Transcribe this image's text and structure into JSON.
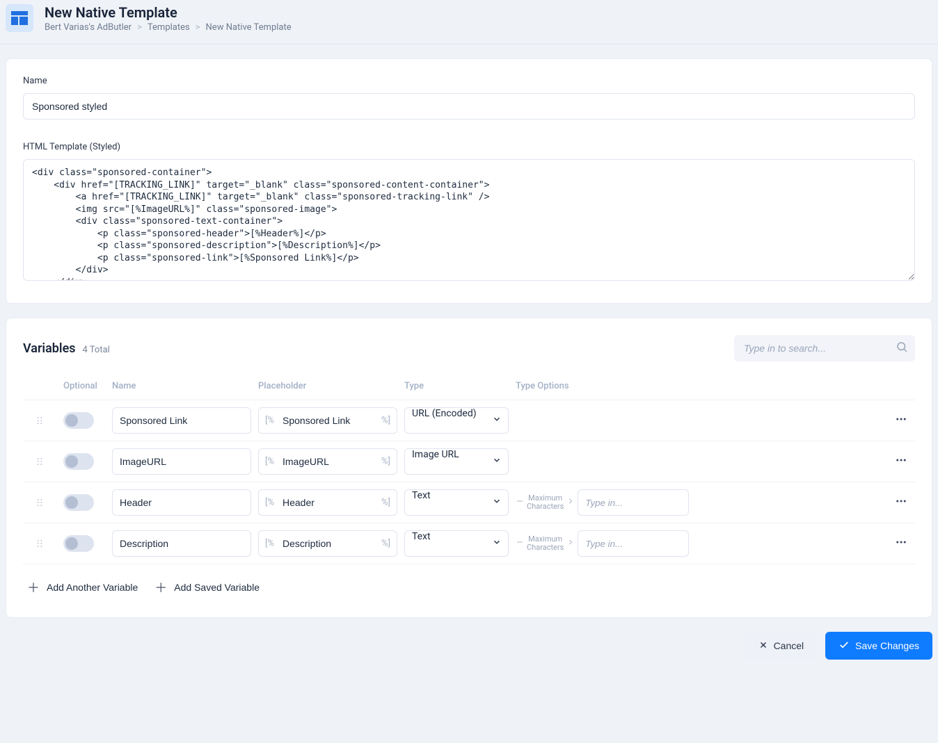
{
  "header": {
    "title": "New Native Template",
    "breadcrumb": [
      "Bert Varias's AdButler",
      "Templates",
      "New Native Template"
    ]
  },
  "form": {
    "name_label": "Name",
    "name_value": "Sponsored styled",
    "html_label": "HTML Template (Styled)",
    "html_value": "<div class=\"sponsored-container\">\n    <div href=\"[TRACKING_LINK]\" target=\"_blank\" class=\"sponsored-content-container\">\n        <a href=\"[TRACKING_LINK]\" target=\"_blank\" class=\"sponsored-tracking-link\" />\n        <img src=\"[%ImageURL%]\" class=\"sponsored-image\">\n        <div class=\"sponsored-text-container\">\n            <p class=\"sponsored-header\">[%Header%]</p>\n            <p class=\"sponsored-description\">[%Description%]</p>\n            <p class=\"sponsored-link\">[%Sponsored Link%]</p>\n        </div>\n    </div>\n    <div class=\"sponsored-close-button-container\">"
  },
  "variables": {
    "title": "Variables",
    "count_text": "4 Total",
    "search_placeholder": "Type in to search...",
    "columns": {
      "optional": "Optional",
      "name": "Name",
      "placeholder": "Placeholder",
      "type": "Type",
      "type_options": "Type Options"
    },
    "placeholder_prefix": "[%",
    "placeholder_suffix": "%]",
    "max_chars_label_top": "Maximum",
    "max_chars_label_bottom": "Characters",
    "max_chars_placeholder": "Type in...",
    "rows": [
      {
        "name": "Sponsored Link",
        "placeholder": "Sponsored Link",
        "type": "URL (Encoded)",
        "has_maxchars": false
      },
      {
        "name": "ImageURL",
        "placeholder": "ImageURL",
        "type": "Image URL",
        "has_maxchars": false
      },
      {
        "name": "Header",
        "placeholder": "Header",
        "type": "Text",
        "has_maxchars": true
      },
      {
        "name": "Description",
        "placeholder": "Description",
        "type": "Text",
        "has_maxchars": true
      }
    ],
    "add_another": "Add Another Variable",
    "add_saved": "Add Saved Variable"
  },
  "footer": {
    "cancel": "Cancel",
    "save": "Save Changes"
  }
}
